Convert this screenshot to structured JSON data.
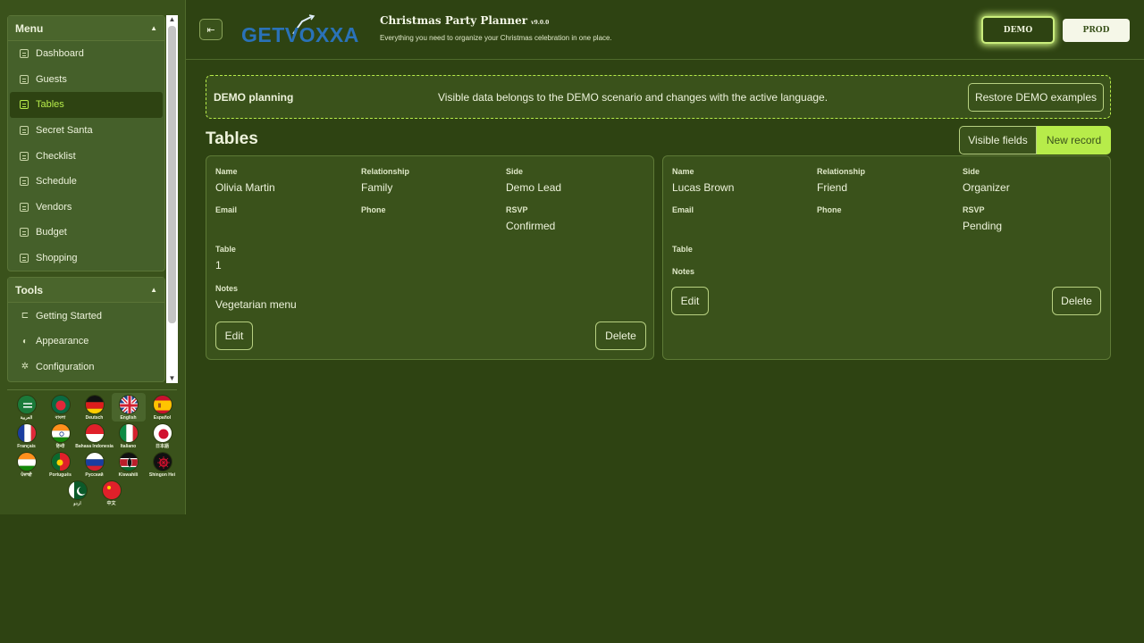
{
  "sidebar": {
    "menu_title": "Menu",
    "menu_items": [
      "Dashboard",
      "Guests",
      "Tables",
      "Secret Santa",
      "Checklist",
      "Schedule",
      "Vendors",
      "Budget",
      "Shopping"
    ],
    "tools_title": "Tools",
    "tool_items": [
      "Getting Started",
      "Appearance",
      "Configuration"
    ]
  },
  "languages": [
    {
      "label": "العربية",
      "icon": "saudi-flag-icon"
    },
    {
      "label": "বাংলা",
      "icon": "bangladesh-flag-icon"
    },
    {
      "label": "Deutsch",
      "icon": "germany-flag-icon"
    },
    {
      "label": "English",
      "icon": "uk-flag-icon"
    },
    {
      "label": "Español",
      "icon": "spain-flag-icon"
    },
    {
      "label": "Français",
      "icon": "france-flag-icon"
    },
    {
      "label": "हिन्दी",
      "icon": "india-flag-icon"
    },
    {
      "label": "Bahasa Indonesia",
      "icon": "indonesia-flag-icon"
    },
    {
      "label": "Italiano",
      "icon": "italy-flag-icon"
    },
    {
      "label": "日本語",
      "icon": "japan-flag-icon"
    },
    {
      "label": "ਪੰਜਾਬੀ",
      "icon": "punjab-flag-icon"
    },
    {
      "label": "Português",
      "icon": "portugal-flag-icon"
    },
    {
      "label": "Русский",
      "icon": "russia-flag-icon"
    },
    {
      "label": "Kiswahili",
      "icon": "kenya-flag-icon"
    },
    {
      "label": "Shingon Hei",
      "icon": "shingon-flag-icon"
    },
    {
      "label": "اردو",
      "icon": "pakistan-flag-icon"
    },
    {
      "label": "中文",
      "icon": "china-flag-icon"
    }
  ],
  "header": {
    "logo_text": "GETVOXXA",
    "title": "Christmas Party Planner",
    "version": "v9.0.0",
    "subtitle": "Everything you need to organize your Christmas celebration in one place.",
    "demo_label": "DEMO",
    "prod_label": "PROD"
  },
  "banner": {
    "title": "DEMO planning",
    "message": "Visible data belongs to the DEMO scenario and changes with the active language.",
    "restore_label": "Restore DEMO examples"
  },
  "main": {
    "title": "Tables",
    "visible_fields_label": "Visible fields",
    "new_record_label": "New record"
  },
  "labels": {
    "name": "Name",
    "relationship": "Relationship",
    "side": "Side",
    "email": "Email",
    "phone": "Phone",
    "rsvp": "RSVP",
    "table": "Table",
    "notes": "Notes",
    "edit": "Edit",
    "delete": "Delete"
  },
  "records": [
    {
      "name": "Olivia Martin",
      "relationship": "Family",
      "side": "Demo Lead",
      "email": "",
      "phone": "",
      "rsvp": "Confirmed",
      "table": "1",
      "notes": "Vegetarian menu"
    },
    {
      "name": "Lucas Brown",
      "relationship": "Friend",
      "side": "Organizer",
      "email": "",
      "phone": "",
      "rsvp": "Pending",
      "table": "",
      "notes": ""
    }
  ],
  "colors": {
    "background": "#2e4312",
    "accent": "#b7ec4a",
    "panel": "#3a521b"
  }
}
